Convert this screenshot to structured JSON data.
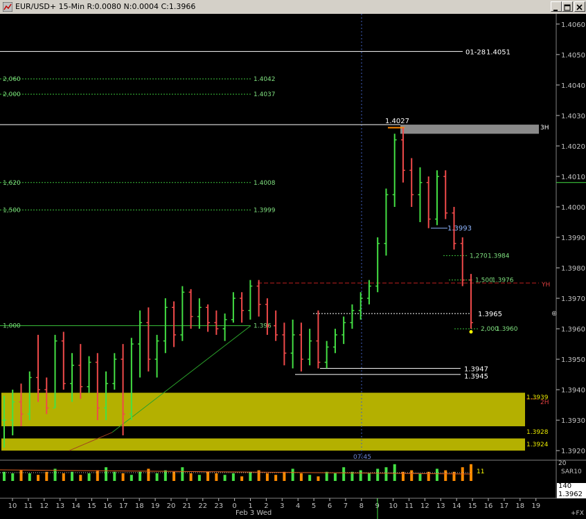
{
  "window": {
    "title": "EUR/USD+ 15-Min R:0.0080 N:0.0004 C:1.3966",
    "buttons": [
      "minimize",
      "maximize",
      "close"
    ]
  },
  "chart_data": {
    "type": "ohlc",
    "symbol": "EUR/USD+",
    "interval": "15-Min",
    "ylim": [
      1.3918,
      1.4062
    ],
    "y_ticks": [
      1.406,
      1.405,
      1.404,
      1.403,
      1.402,
      1.401,
      1.4,
      1.399,
      1.398,
      1.397,
      1.396,
      1.395,
      1.394,
      1.393,
      1.392
    ],
    "x_tick_labels": [
      "10",
      "11",
      "12",
      "13",
      "14",
      "15",
      "16",
      "17",
      "18",
      "19",
      "20",
      "21",
      "22",
      "23",
      "0",
      "1",
      "2",
      "3",
      "4",
      "5",
      "6",
      "7",
      "8",
      "9",
      "10",
      "11",
      "12",
      "13",
      "14",
      "15",
      "16",
      "17",
      "18",
      "19"
    ],
    "date_label": "Feb 3 Wed",
    "levels": [
      {
        "label": "01-28",
        "price": "1.4051",
        "value": 1.4051,
        "color": "#ffffff"
      },
      {
        "label": "",
        "price": "1.4027",
        "value": 1.4027,
        "color": "#ffffff"
      },
      {
        "label": "",
        "price": "1.3947",
        "value": 1.3947,
        "color": "#ffffff"
      },
      {
        "label": "",
        "price": "1.3945",
        "value": 1.3945,
        "color": "#ffffff"
      },
      {
        "label": "",
        "price": "1.3965",
        "value": 1.3965,
        "color": "#ffffff"
      }
    ],
    "fib_levels": [
      {
        "ratio": "2,060",
        "price": "1.4042",
        "value": 1.4042
      },
      {
        "ratio": "2,000",
        "price": "1.4037",
        "value": 1.4037
      },
      {
        "ratio": "1,620",
        "price": "1.4008",
        "value": 1.4008
      },
      {
        "ratio": "1,500",
        "price": "1.3999",
        "value": 1.3999
      },
      {
        "ratio": "1,000",
        "price": "1.396",
        "value": 1.3961
      }
    ],
    "fib_projection": [
      {
        "ratio": "1,270",
        "price": "1.3984",
        "value": 1.3984
      },
      {
        "ratio": "1,500",
        "price": "1.3976",
        "value": 1.3976
      },
      {
        "ratio": "2,000",
        "price": "1.3960",
        "value": 1.396
      }
    ],
    "annotations": {
      "high_label": "1.4027",
      "pivot_label": "1.3993",
      "yh_label": "YH",
      "yh_value": 1.3975,
      "zone_3h_label": "3H",
      "zone_2h_label": "2H",
      "zone_upper_top": "1.3939",
      "zone_upper_bottom": "1.3928",
      "zone_lower_top": "1.3924",
      "time_label": "07:45"
    },
    "last_price": "1.3962",
    "volume_panel": {
      "indicator": "SAR10",
      "value_label": "11",
      "scale_top": "20",
      "scale_bottom": "140"
    },
    "corner_label": "+FX",
    "bars": [
      [
        1.393,
        1.3938,
        1.3921,
        1.393
      ],
      [
        1.393,
        1.394,
        1.3925,
        1.3936
      ],
      [
        1.3936,
        1.3942,
        1.3928,
        1.3932
      ],
      [
        1.3932,
        1.3946,
        1.393,
        1.3944
      ],
      [
        1.3944,
        1.3958,
        1.3936,
        1.394
      ],
      [
        1.394,
        1.3944,
        1.3932,
        1.3934
      ],
      [
        1.3934,
        1.3958,
        1.3934,
        1.3956
      ],
      [
        1.3956,
        1.3959,
        1.394,
        1.3942
      ],
      [
        1.3942,
        1.3952,
        1.3936,
        1.3948
      ],
      [
        1.3948,
        1.3955,
        1.3937,
        1.3941
      ],
      [
        1.3941,
        1.3951,
        1.3939,
        1.3949
      ],
      [
        1.3949,
        1.3952,
        1.393,
        1.3934
      ],
      [
        1.3934,
        1.3946,
        1.393,
        1.3942
      ],
      [
        1.3942,
        1.3952,
        1.394,
        1.395
      ],
      [
        1.395,
        1.3955,
        1.3925,
        1.3932
      ],
      [
        1.3932,
        1.3957,
        1.393,
        1.3955
      ],
      [
        1.3955,
        1.3966,
        1.3944,
        1.3962
      ],
      [
        1.3962,
        1.3967,
        1.3946,
        1.395
      ],
      [
        1.395,
        1.3958,
        1.3944,
        1.3956
      ],
      [
        1.3956,
        1.397,
        1.3952,
        1.3967
      ],
      [
        1.3967,
        1.3969,
        1.3954,
        1.3958
      ],
      [
        1.3958,
        1.3974,
        1.3956,
        1.3972
      ],
      [
        1.3972,
        1.3973,
        1.396,
        1.3964
      ],
      [
        1.3964,
        1.397,
        1.396,
        1.3967
      ],
      [
        1.3967,
        1.3968,
        1.3959,
        1.3962
      ],
      [
        1.3962,
        1.3966,
        1.3958,
        1.396
      ],
      [
        1.396,
        1.3965,
        1.3956,
        1.3963
      ],
      [
        1.3963,
        1.3972,
        1.3962,
        1.397
      ],
      [
        1.397,
        1.3972,
        1.3962,
        1.3966
      ],
      [
        1.3966,
        1.3976,
        1.3963,
        1.3974
      ],
      [
        1.3974,
        1.3976,
        1.3964,
        1.3968
      ],
      [
        1.3968,
        1.397,
        1.3958,
        1.3961
      ],
      [
        1.3961,
        1.3966,
        1.3956,
        1.3958
      ],
      [
        1.3958,
        1.3962,
        1.3948,
        1.3952
      ],
      [
        1.3952,
        1.3963,
        1.3947,
        1.3958
      ],
      [
        1.3958,
        1.3962,
        1.3946,
        1.395
      ],
      [
        1.395,
        1.396,
        1.3948,
        1.3956
      ],
      [
        1.3956,
        1.3966,
        1.3947,
        1.3949
      ],
      [
        1.3949,
        1.3956,
        1.3947,
        1.3954
      ],
      [
        1.3954,
        1.396,
        1.3952,
        1.3958
      ],
      [
        1.3958,
        1.3964,
        1.3955,
        1.3962
      ],
      [
        1.3962,
        1.3968,
        1.396,
        1.3966
      ],
      [
        1.3966,
        1.3972,
        1.3963,
        1.397
      ],
      [
        1.397,
        1.3976,
        1.3968,
        1.3974
      ],
      [
        1.3974,
        1.399,
        1.3972,
        1.3988
      ],
      [
        1.3988,
        1.4006,
        1.3984,
        1.4004
      ],
      [
        1.4004,
        1.4024,
        1.4,
        1.4022
      ],
      [
        1.4022,
        1.4026,
        1.4008,
        1.4012
      ],
      [
        1.4012,
        1.4016,
        1.4,
        1.4004
      ],
      [
        1.4004,
        1.4013,
        1.3995,
        1.4008
      ],
      [
        1.4008,
        1.401,
        1.3993,
        1.3996
      ],
      [
        1.3996,
        1.4012,
        1.3994,
        1.401
      ],
      [
        1.401,
        1.4012,
        1.3996,
        1.3998
      ],
      [
        1.3998,
        1.4,
        1.3986,
        1.3988
      ],
      [
        1.3988,
        1.399,
        1.3974,
        1.3976
      ],
      [
        1.3976,
        1.3978,
        1.396,
        1.3962
      ]
    ],
    "volume": [
      6,
      5,
      7,
      5,
      4,
      6,
      8,
      5,
      6,
      4,
      5,
      7,
      9,
      6,
      5,
      4,
      6,
      8,
      5,
      7,
      6,
      9,
      5,
      4,
      6,
      5,
      4,
      5,
      3,
      6,
      7,
      5,
      4,
      6,
      8,
      5,
      4,
      3,
      6,
      5,
      9,
      6,
      7,
      5,
      8,
      9,
      11,
      6,
      7,
      5,
      6,
      8,
      7,
      6,
      9,
      11
    ],
    "last_bar_volume": 11
  }
}
